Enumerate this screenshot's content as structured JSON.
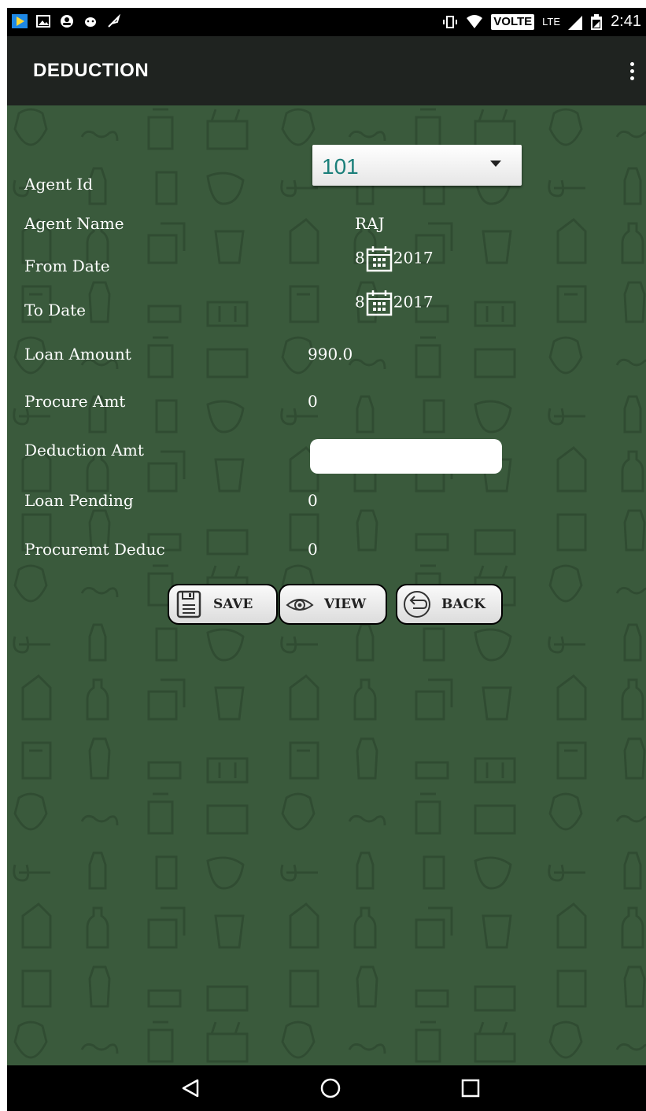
{
  "status_bar": {
    "time": "2:41",
    "network_label": "VOLTE",
    "lte_label": "LTE"
  },
  "app_bar": {
    "title": "DEDUCTION",
    "menu_icon": "overflow-menu-icon"
  },
  "form": {
    "agent_id": {
      "label": "Agent Id",
      "selected": "101"
    },
    "agent_name": {
      "label": "Agent Name",
      "value": "RAJ"
    },
    "from_date": {
      "label": "From Date",
      "value_prefix": "8",
      "value_suffix": "2017"
    },
    "to_date": {
      "label": "To Date",
      "value_prefix": "8",
      "value_suffix": "2017"
    },
    "loan_amount": {
      "label": "Loan Amount",
      "value": "990.0"
    },
    "procure_amt": {
      "label": "Procure Amt",
      "value": "0"
    },
    "deduction_amt": {
      "label": "Deduction Amt",
      "value": "",
      "placeholder": ""
    },
    "loan_pending": {
      "label": "Loan Pending",
      "value": "0"
    },
    "procuremt_deduc": {
      "label": "Procuremt Deduc",
      "value": "0"
    }
  },
  "buttons": {
    "save": {
      "label": "SAVE",
      "icon": "save-icon"
    },
    "view": {
      "label": "VIEW",
      "icon": "eye-icon"
    },
    "back": {
      "label": "BACK",
      "icon": "back-arrow-icon"
    }
  },
  "nav_bar": {
    "back": "back-nav-icon",
    "home": "home-nav-icon",
    "recents": "recents-nav-icon"
  },
  "colors": {
    "content_bg": "#3a5a3c",
    "appbar_bg": "#1f2320",
    "spinner_text": "#1b7f7a"
  }
}
